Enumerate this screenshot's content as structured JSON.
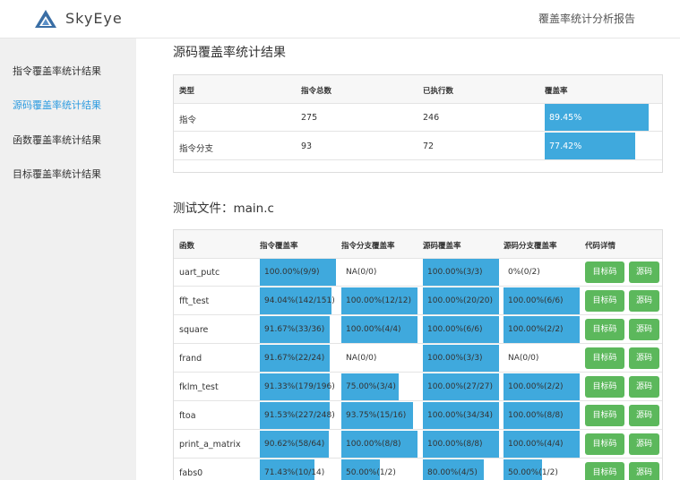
{
  "header": {
    "brand": "SkyEye",
    "report_title": "覆盖率统计分析报告"
  },
  "sidebar": {
    "items": [
      {
        "label": "指令覆盖率统计结果",
        "active": false
      },
      {
        "label": "源码覆盖率统计结果",
        "active": true
      },
      {
        "label": "函数覆盖率统计结果",
        "active": false
      },
      {
        "label": "目标覆盖率统计结果",
        "active": false
      }
    ]
  },
  "summary": {
    "title": "源码覆盖率统计结果",
    "headers": [
      "类型",
      "指令总数",
      "已执行数",
      "覆盖率"
    ],
    "rows": [
      {
        "type": "指令",
        "total": "275",
        "executed": "246",
        "rate": "89.45%",
        "pct": 89.45
      },
      {
        "type": "指令分支",
        "total": "93",
        "executed": "72",
        "rate": "77.42%",
        "pct": 77.42
      }
    ]
  },
  "file": {
    "title": "测试文件：main.c",
    "headers": [
      "函数",
      "指令覆盖率",
      "指令分支覆盖率",
      "源码覆盖率",
      "源码分支覆盖率",
      "代码详情"
    ],
    "btn_target": "目标码",
    "btn_source": "源码",
    "rows": [
      {
        "name": "uart_putc",
        "c1": "100.00%(9/9)",
        "p1": 100,
        "c2": "NA(0/0)",
        "p2": 0,
        "c3": "100.00%(3/3)",
        "p3": 100,
        "c4": "0%(0/2)",
        "p4": 0
      },
      {
        "name": "fft_test",
        "c1": "94.04%(142/151)",
        "p1": 94.04,
        "c2": "100.00%(12/12)",
        "p2": 100,
        "c3": "100.00%(20/20)",
        "p3": 100,
        "c4": "100.00%(6/6)",
        "p4": 100
      },
      {
        "name": "square",
        "c1": "91.67%(33/36)",
        "p1": 91.67,
        "c2": "100.00%(4/4)",
        "p2": 100,
        "c3": "100.00%(6/6)",
        "p3": 100,
        "c4": "100.00%(2/2)",
        "p4": 100
      },
      {
        "name": "frand",
        "c1": "91.67%(22/24)",
        "p1": 91.67,
        "c2": "NA(0/0)",
        "p2": 0,
        "c3": "100.00%(3/3)",
        "p3": 100,
        "c4": "NA(0/0)",
        "p4": 0
      },
      {
        "name": "fklm_test",
        "c1": "91.33%(179/196)",
        "p1": 91.33,
        "c2": "75.00%(3/4)",
        "p2": 75,
        "c3": "100.00%(27/27)",
        "p3": 100,
        "c4": "100.00%(2/2)",
        "p4": 100
      },
      {
        "name": "ftoa",
        "c1": "91.53%(227/248)",
        "p1": 91.53,
        "c2": "93.75%(15/16)",
        "p2": 93.75,
        "c3": "100.00%(34/34)",
        "p3": 100,
        "c4": "100.00%(8/8)",
        "p4": 100
      },
      {
        "name": "print_a_matrix",
        "c1": "90.62%(58/64)",
        "p1": 90.62,
        "c2": "100.00%(8/8)",
        "p2": 100,
        "c3": "100.00%(8/8)",
        "p3": 100,
        "c4": "100.00%(4/4)",
        "p4": 100
      },
      {
        "name": "fabs0",
        "c1": "71.43%(10/14)",
        "p1": 71.43,
        "c2": "50.00%(1/2)",
        "p2": 50,
        "c3": "80.00%(4/5)",
        "p3": 80,
        "c4": "50.00%(1/2)",
        "p4": 50
      }
    ]
  },
  "colors": {
    "bar": "#3fa9dd",
    "button": "#5cb85c",
    "active_nav": "#2d9be0"
  }
}
